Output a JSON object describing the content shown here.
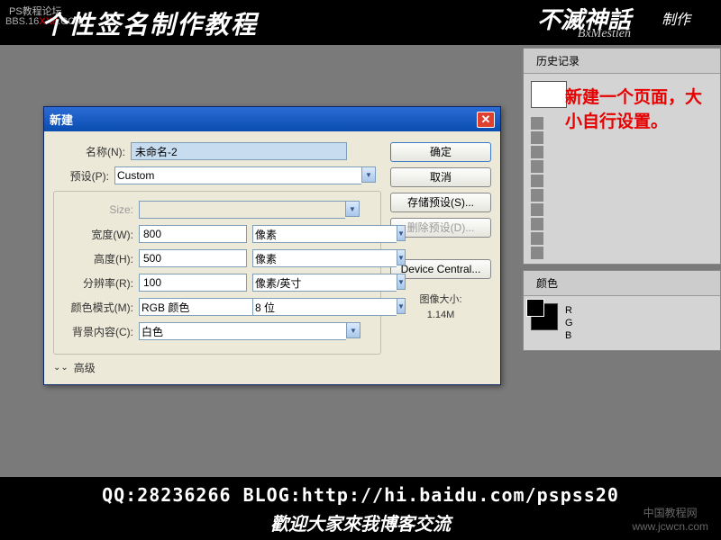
{
  "header": {
    "small_text": "PS教程论坛",
    "bbs_prefix": "BBS.16",
    "bbs_red": "XX8",
    "bbs_suffix": ".COM",
    "title": "个性签名制作教程",
    "brand_main": "不滅神話",
    "brand_sub": "制作",
    "brand_eng": "BxMestień"
  },
  "annotation": "新建一个页面，大小自行设置。",
  "dialog": {
    "title": "新建",
    "name_label": "名称(N):",
    "name_value": "未命名-2",
    "preset_label": "预设(P):",
    "preset_value": "Custom",
    "size_label": "Size:",
    "width_label": "宽度(W):",
    "width_value": "800",
    "width_unit": "像素",
    "height_label": "高度(H):",
    "height_value": "500",
    "height_unit": "像素",
    "resolution_label": "分辨率(R):",
    "resolution_value": "100",
    "resolution_unit": "像素/英寸",
    "color_mode_label": "颜色模式(M):",
    "color_mode_value": "RGB 颜色",
    "color_depth": "8 位",
    "bg_label": "背景内容(C):",
    "bg_value": "白色",
    "advanced": "高级",
    "btn_ok": "确定",
    "btn_cancel": "取消",
    "btn_save_preset": "存储预设(S)...",
    "btn_del_preset": "删除预设(D)...",
    "btn_device_central": "Device Central...",
    "image_size_label": "图像大小:",
    "image_size_value": "1.14M"
  },
  "history_panel": {
    "tab": "历史记录"
  },
  "color_panel": {
    "tab": "颜色",
    "r": "R",
    "g": "G",
    "b": "B"
  },
  "footer": {
    "line1": "QQ:28236266  BLOG:http://hi.baidu.com/pspss20",
    "line2": "歡迎大家來我博客交流",
    "watermark": "中国教程网",
    "watermark_url": "www.jcwcn.com"
  }
}
